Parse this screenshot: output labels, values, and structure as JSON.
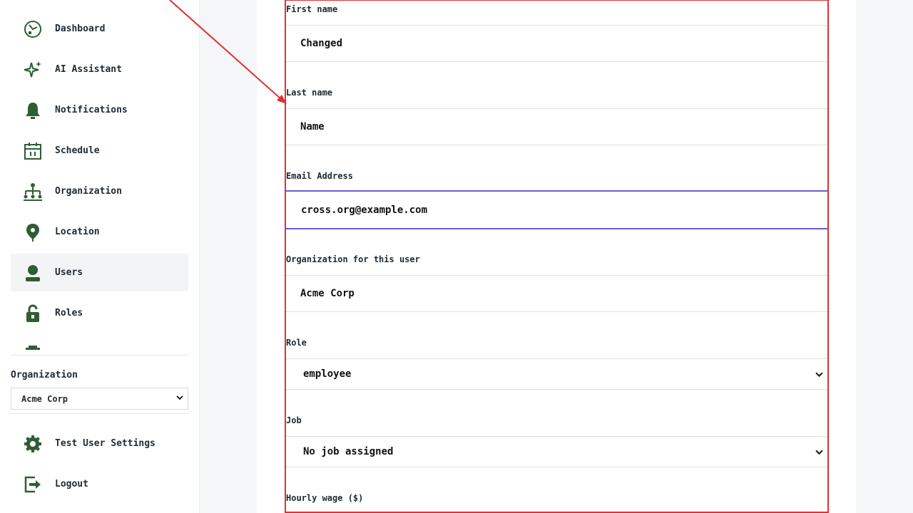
{
  "sidebar": {
    "items": [
      {
        "label": "Dashboard",
        "icon": "dashboard-icon"
      },
      {
        "label": "AI Assistant",
        "icon": "sparkle-icon"
      },
      {
        "label": "Notifications",
        "icon": "bell-icon"
      },
      {
        "label": "Schedule",
        "icon": "calendar-icon"
      },
      {
        "label": "Organization",
        "icon": "org-chart-icon"
      },
      {
        "label": "Location",
        "icon": "location-pin-icon"
      },
      {
        "label": "Users",
        "icon": "user-icon",
        "active": true
      },
      {
        "label": "Roles",
        "icon": "lock-icon"
      }
    ],
    "organization_label": "Organization",
    "organization_value": "Acme Corp",
    "bottom_items": [
      {
        "label": "Test User Settings",
        "icon": "gear-icon"
      },
      {
        "label": "Logout",
        "icon": "logout-icon"
      }
    ]
  },
  "form": {
    "first_name_label": "First name",
    "first_name_value": "Changed",
    "last_name_label": "Last name",
    "last_name_value": "Name",
    "email_label": "Email Address",
    "email_value": "cross.org@example.com",
    "organization_label": "Organization for this user",
    "organization_value": "Acme Corp",
    "role_label": "Role",
    "role_value": "employee",
    "job_label": "Job",
    "job_value": "No job assigned",
    "hourly_wage_label": "Hourly wage ($)"
  },
  "colors": {
    "icon_green": "#2f5d34",
    "annotation_red": "#e03131",
    "focus_purple": "#6b5bd6"
  }
}
